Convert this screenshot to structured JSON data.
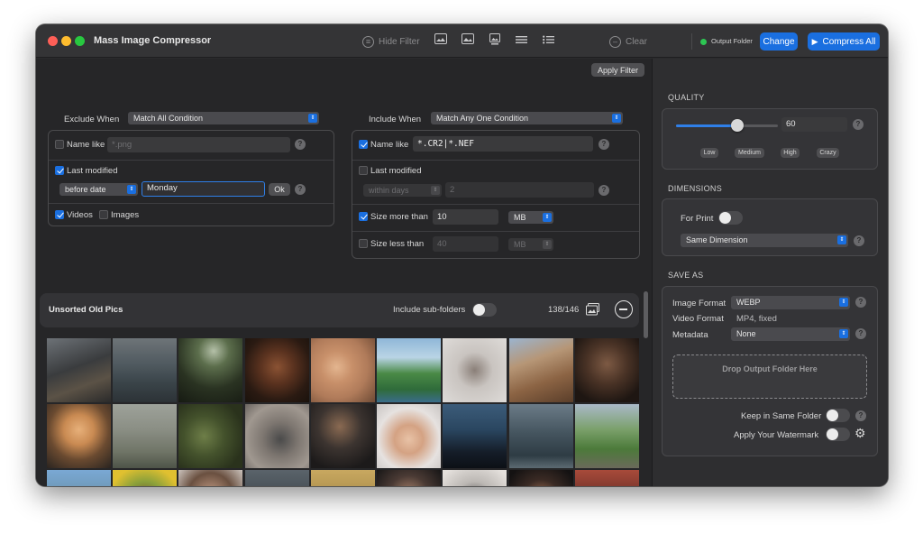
{
  "app": {
    "title": "Mass Image Compressor"
  },
  "toolbar": {
    "hide_filter": "Hide Filter",
    "clear": "Clear",
    "output_folder": "Output Folder",
    "change": "Change",
    "compress_all": "Compress All"
  },
  "filters": {
    "apply_filter": "Apply Filter",
    "exclude": {
      "label": "Exclude When",
      "condition": "Match All Condition",
      "name_like_label": "Name like",
      "name_like_placeholder": "*.png",
      "last_modified_label": "Last modified",
      "date_mode": "before date",
      "date_value": "Monday",
      "ok": "Ok",
      "videos_label": "Videos",
      "images_label": "Images"
    },
    "include": {
      "label": "Include When",
      "condition": "Match Any One Condition",
      "name_like_label": "Name like",
      "name_like_value": "*.CR2|*.NEF",
      "last_modified_label": "Last modified",
      "last_modified_mode": "within days",
      "last_modified_value": "2",
      "size_more_label": "Size more than",
      "size_more_value": "10",
      "size_more_unit": "MB",
      "size_less_label": "Size less than",
      "size_less_value": "40",
      "size_less_unit": "MB"
    }
  },
  "folder": {
    "name": "Unsorted Old Pics",
    "include_subfolders": "Include sub-folders",
    "count": "138/146"
  },
  "quality": {
    "title": "QUALITY",
    "value": "60",
    "level": 0.6,
    "presets": [
      "Low",
      "Medium",
      "High",
      "Crazy"
    ]
  },
  "dimensions": {
    "title": "DIMENSIONS",
    "for_print": "For Print",
    "mode": "Same Dimension"
  },
  "save_as": {
    "title": "SAVE AS",
    "image_format_label": "Image Format",
    "image_format": "WEBP",
    "video_format_label": "Video Format",
    "video_format": "MP4, fixed",
    "metadata_label": "Metadata",
    "metadata": "None",
    "drop": "Drop Output Folder Here",
    "keep_same_folder": "Keep in Same Folder",
    "apply_watermark": "Apply Your Watermark"
  },
  "colors": {
    "accent": "#1a6fe0",
    "status_green": "#2dc653"
  }
}
